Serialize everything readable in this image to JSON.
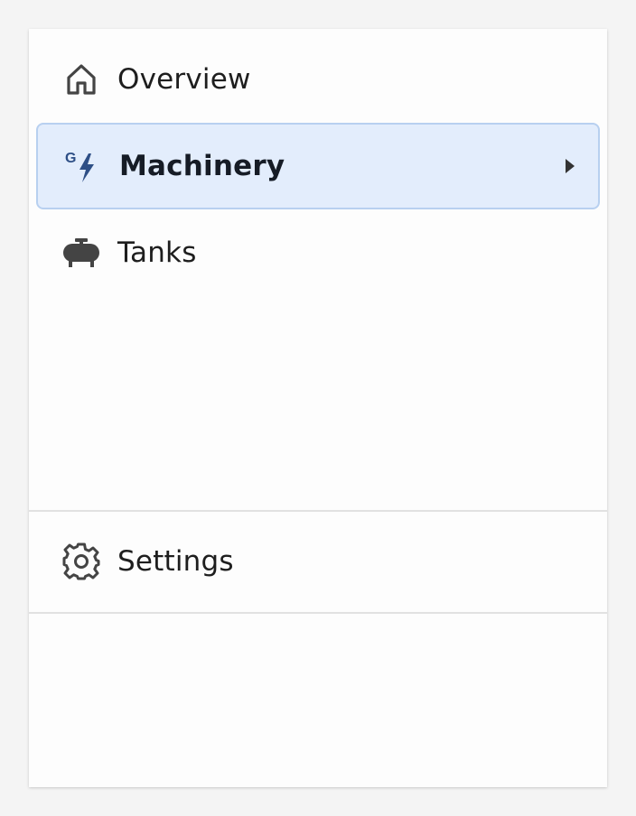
{
  "nav": {
    "items": [
      {
        "label": "Overview",
        "icon": "home-icon",
        "active": false
      },
      {
        "label": "Machinery",
        "icon": "generator-icon",
        "icon_text": "G",
        "active": true,
        "has_submenu": true
      },
      {
        "label": "Tanks",
        "icon": "tank-icon",
        "active": false
      }
    ]
  },
  "footer": {
    "settings_label": "Settings",
    "settings_icon": "gear-icon"
  },
  "colors": {
    "active_background": "#e3edfc",
    "active_border": "#b8d0f0",
    "accent_icon": "#2e4f86",
    "icon_default": "#444444",
    "page_background": "#f4f4f4",
    "panel_background": "#fdfdfd"
  }
}
